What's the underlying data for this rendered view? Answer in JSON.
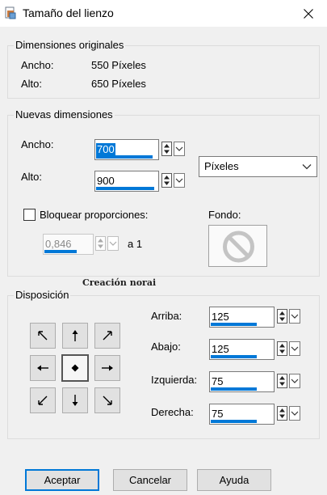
{
  "window": {
    "title": "Tamaño del lienzo"
  },
  "original": {
    "legend": "Dimensiones originales",
    "width_label": "Ancho:",
    "width_value": "550 Píxeles",
    "height_label": "Alto:",
    "height_value": "650 Píxeles"
  },
  "new_dims": {
    "legend": "Nuevas dimensiones",
    "width_label": "Ancho:",
    "width_value": "700",
    "height_label": "Alto:",
    "height_value": "900",
    "unit_selected": "Píxeles",
    "lock_label": "Bloquear proporciones:",
    "lock_checked": false,
    "ratio_value": "0,846",
    "ratio_suffix": "a 1",
    "background_label": "Fondo:"
  },
  "layout_group": {
    "legend": "Disposición",
    "top_label": "Arriba:",
    "top_value": "125",
    "bottom_label": "Abajo:",
    "bottom_value": "125",
    "left_label": "Izquierda:",
    "left_value": "75",
    "right_label": "Derecha:",
    "right_value": "75",
    "anchor_selected": "center"
  },
  "overlay_text": "Creación norai",
  "buttons": {
    "ok": "Aceptar",
    "cancel": "Cancelar",
    "help": "Ayuda"
  },
  "colors": {
    "accent": "#0078d7",
    "background": "#f0f0f0"
  }
}
